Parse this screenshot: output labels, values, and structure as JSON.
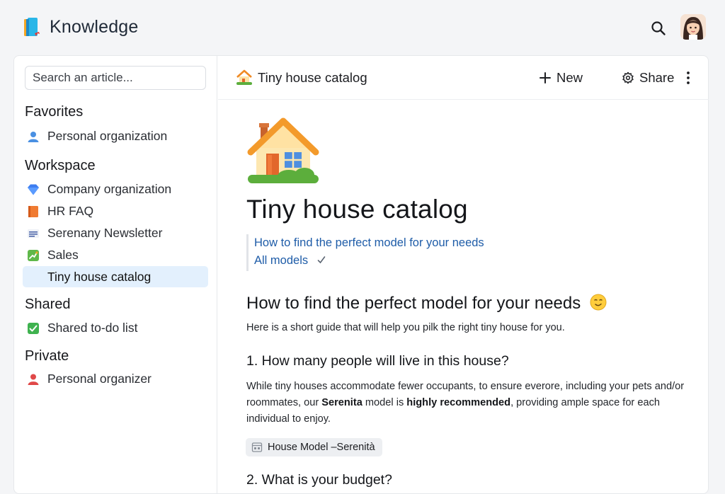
{
  "app": {
    "title": "Knowledge",
    "logo_icon": "book-icon",
    "accent": "#1e5ca8"
  },
  "topbar": {
    "search_icon": "search-icon",
    "avatar": "user-avatar"
  },
  "sidebar": {
    "search": {
      "placeholder": "Search an article..."
    },
    "sections": [
      {
        "title": "Favorites",
        "items": [
          {
            "label": "Personal organization",
            "icon": "person-icon"
          }
        ]
      },
      {
        "title": "Workspace",
        "items": [
          {
            "label": "Company organization",
            "icon": "diamond-icon"
          },
          {
            "label": "HR FAQ",
            "icon": "book-icon"
          },
          {
            "label": "Serenany Newsletter",
            "icon": "newsletter-icon"
          },
          {
            "label": "Sales",
            "icon": "chart-icon"
          },
          {
            "label": "Tiny house catalog",
            "icon": "",
            "active": true
          }
        ]
      },
      {
        "title": "Shared",
        "items": [
          {
            "label": "Shared to-do list",
            "icon": "checkbox-icon"
          }
        ]
      },
      {
        "title": "Private",
        "items": [
          {
            "label": "Personal organizer",
            "icon": "person-icon"
          }
        ]
      }
    ]
  },
  "header": {
    "title": "Tiny house catalog",
    "icon": "house-icon",
    "new_label": "New",
    "share_label": "Share"
  },
  "article": {
    "title": "Tiny house catalog",
    "toc": [
      "How to find the perfect model for your needs",
      "All models"
    ],
    "section_heading": "How to find the perfect model for your needs",
    "intro": "Here is a short guide that will help you pilk the right tiny house for you.",
    "q1": "1.  How many people will live in this house?",
    "para": {
      "part1": "While tiny houses accommodate fewer occupants, to ensure everore, including your pets and/or roommates, our ",
      "bold1": "Serenita",
      "part2": " model is ",
      "bold2": "highly recommended",
      "part3": ", providing ample space for each individual to enjoy."
    },
    "chip": "House Model –Serenità",
    "q2": "2.  What is your budget?"
  }
}
